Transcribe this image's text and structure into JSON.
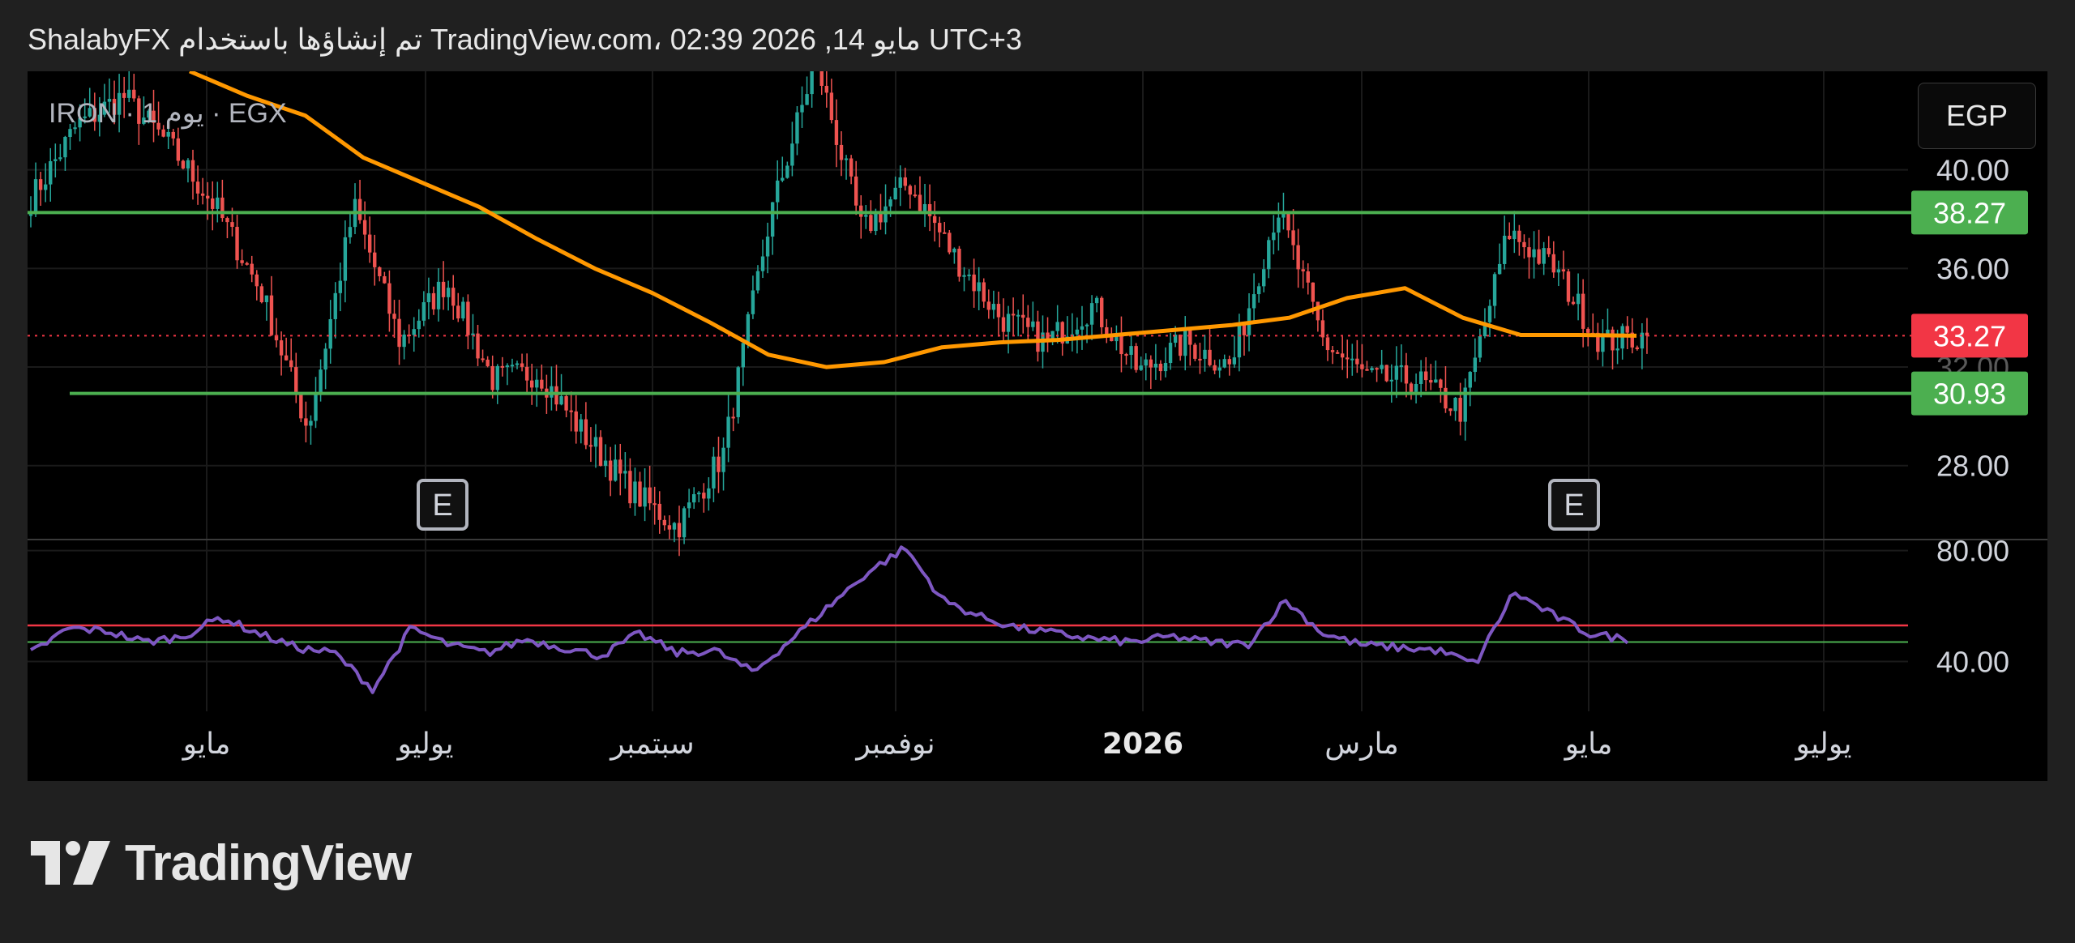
{
  "header": {
    "watermark_text": "ShalabyFX تم إنشاؤها باستخدام TradingView.com، 02:39 2026 ,14 مايو UTC+3"
  },
  "symbol": {
    "label": "IRON · 1 يوم · EGX"
  },
  "currency_button": "EGP",
  "brand": {
    "name": "TradingView"
  },
  "colors": {
    "up_candle": "#26a69a",
    "down_candle": "#ef5350",
    "ma_line": "#ff9800",
    "support_line": "#4caf50",
    "price_line": "#f23645",
    "rsi_line": "#7e57c2",
    "rsi_upper": "#f23645",
    "rsi_lower": "#4caf50"
  },
  "chart_data": [
    {
      "type": "candlestick",
      "y_axis_ticks": [
        "40.00",
        "36.00",
        "28.00"
      ],
      "ylim": [
        25.0,
        44.0
      ],
      "x_axis_labels": [
        "مايو",
        "يوليو",
        "سبتمبر",
        "نوفمبر",
        "2026",
        "مارس",
        "مايو",
        "يوليو"
      ],
      "last_price": 33.27,
      "last_price_label": "33.27",
      "hidden_tick_label": "32.00",
      "horizontal_levels": [
        {
          "value": 38.27,
          "label": "38.27"
        },
        {
          "value": 30.93,
          "label": "30.93"
        }
      ],
      "earnings_markers": [
        "E",
        "E"
      ],
      "close_path": [
        38.8,
        41.8,
        43.0,
        41.0,
        38.5,
        35.0,
        29.5,
        38.5,
        33.0,
        35.5,
        31.5,
        31.8,
        29.2,
        27.0,
        25.5,
        28.5,
        38.0,
        44.5,
        37.5,
        39.5,
        36.5,
        34.0,
        33.0,
        34.5,
        31.8,
        33.0,
        32.0,
        38.5,
        33.0,
        31.5,
        31.5,
        30.2,
        37.5,
        36.0,
        33.0,
        33.27
      ],
      "moving_average": [
        44.0,
        43.0,
        42.2,
        40.5,
        39.5,
        38.5,
        37.2,
        36.0,
        35.0,
        33.8,
        32.5,
        32.0,
        32.2,
        32.8,
        33.0,
        33.1,
        33.3,
        33.5,
        33.7,
        34.0,
        34.8,
        35.2,
        34.0,
        33.3,
        33.3,
        33.27
      ]
    },
    {
      "type": "line",
      "y_axis_ticks": [
        "80.00",
        "40.00"
      ],
      "ylim": [
        22,
        84
      ],
      "upper_band": 53,
      "lower_band": 47,
      "rsi_values": [
        43,
        52,
        51,
        47,
        49,
        56,
        50,
        45,
        43,
        30,
        52,
        46,
        43,
        48,
        45,
        42,
        50,
        43,
        44,
        36,
        48,
        60,
        72,
        81,
        62,
        56,
        52,
        50,
        48,
        47,
        49,
        47,
        46,
        62,
        50,
        46,
        45,
        44,
        39,
        65,
        57,
        50,
        48
      ]
    }
  ]
}
